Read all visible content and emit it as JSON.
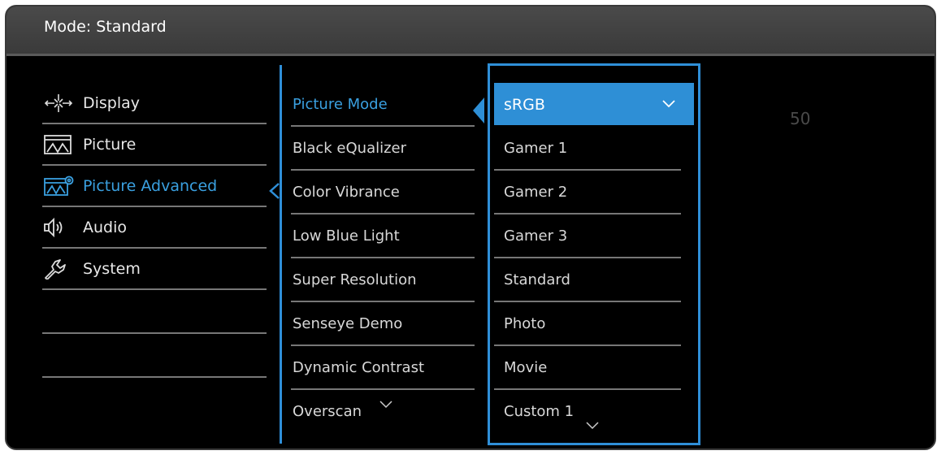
{
  "header": {
    "title": "Mode: Standard"
  },
  "nav": {
    "items": [
      {
        "label": "Display",
        "icon": "display-icon"
      },
      {
        "label": "Picture",
        "icon": "picture-icon"
      },
      {
        "label": "Picture Advanced",
        "icon": "picture-advanced-icon",
        "active": true
      },
      {
        "label": "Audio",
        "icon": "audio-icon"
      },
      {
        "label": "System",
        "icon": "system-icon"
      }
    ]
  },
  "submenu": {
    "items": [
      {
        "label": "Picture Mode",
        "active": true
      },
      {
        "label": "Black eQualizer"
      },
      {
        "label": "Color Vibrance"
      },
      {
        "label": "Low Blue Light"
      },
      {
        "label": "Super Resolution"
      },
      {
        "label": "Senseye Demo"
      },
      {
        "label": "Dynamic Contrast"
      },
      {
        "label": "Overscan"
      }
    ]
  },
  "options": {
    "items": [
      {
        "label": "sRGB",
        "selected": true
      },
      {
        "label": "Gamer 1"
      },
      {
        "label": "Gamer 2"
      },
      {
        "label": "Gamer 3"
      },
      {
        "label": "Standard"
      },
      {
        "label": "Photo"
      },
      {
        "label": "Movie"
      },
      {
        "label": "Custom 1"
      }
    ]
  },
  "value_display": "50",
  "colors": {
    "accent": "#2e8fd6",
    "background": "#000000",
    "header": "#404040"
  }
}
